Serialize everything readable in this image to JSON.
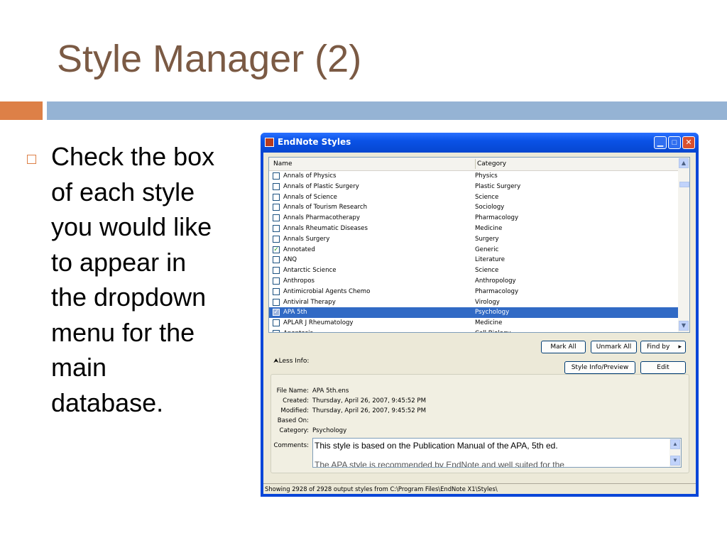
{
  "slide": {
    "title": "Style Manager (2)",
    "bullet": "Check the box of each style you would like to appear in the dropdown menu for the main database.",
    "colors": {
      "title": "#7b5a44",
      "accent_orange": "#dd8047",
      "accent_blue": "#95b3d4"
    }
  },
  "window": {
    "title": "EndNote Styles",
    "controls": {
      "minimize": "minimize-icon",
      "maximize": "maximize-icon",
      "close": "close-icon"
    },
    "list": {
      "columns": {
        "name": "Name",
        "category": "Category"
      },
      "rows": [
        {
          "name": "Annals of Physics",
          "category": "Physics",
          "checked": false,
          "selected": false
        },
        {
          "name": "Annals of Plastic Surgery",
          "category": "Plastic Surgery",
          "checked": false,
          "selected": false
        },
        {
          "name": "Annals of Science",
          "category": "Science",
          "checked": false,
          "selected": false
        },
        {
          "name": "Annals of Tourism Research",
          "category": "Sociology",
          "checked": false,
          "selected": false
        },
        {
          "name": "Annals Pharmacotherapy",
          "category": "Pharmacology",
          "checked": false,
          "selected": false
        },
        {
          "name": "Annals Rheumatic Diseases",
          "category": "Medicine",
          "checked": false,
          "selected": false
        },
        {
          "name": "Annals Surgery",
          "category": "Surgery",
          "checked": false,
          "selected": false
        },
        {
          "name": "Annotated",
          "category": "Generic",
          "checked": true,
          "selected": false
        },
        {
          "name": "ANQ",
          "category": "Literature",
          "checked": false,
          "selected": false
        },
        {
          "name": "Antarctic Science",
          "category": "Science",
          "checked": false,
          "selected": false
        },
        {
          "name": "Anthropos",
          "category": "Anthropology",
          "checked": false,
          "selected": false
        },
        {
          "name": "Antimicrobial Agents Chemo",
          "category": "Pharmacology",
          "checked": false,
          "selected": false
        },
        {
          "name": "Antiviral Therapy",
          "category": "Virology",
          "checked": false,
          "selected": false
        },
        {
          "name": "APA 5th",
          "category": "Psychology",
          "checked": true,
          "selected": true
        },
        {
          "name": "APLAR J Rheumatology",
          "category": "Medicine",
          "checked": false,
          "selected": false
        },
        {
          "name": "Apoptosis",
          "category": "Cell Biology",
          "checked": false,
          "selected": false
        }
      ]
    },
    "buttons": {
      "mark_all": "Mark All",
      "unmark_all": "Unmark All",
      "find_by": "Find by",
      "style_info": "Style Info/Preview",
      "edit": "Edit"
    },
    "less_info": "Less Info:",
    "info": {
      "file_name_label": "File Name:",
      "file_name": "APA 5th.ens",
      "created_label": "Created:",
      "created": "Thursday, April 26, 2007, 9:45:52 PM",
      "modified_label": "Modified:",
      "modified": "Thursday, April 26, 2007, 9:45:52 PM",
      "based_on_label": "Based On:",
      "based_on": "",
      "category_label": "Category:",
      "category": "Psychology",
      "comments_label": "Comments:",
      "comments": "This style is based on the Publication Manual of the APA, 5th ed.",
      "comments_line2": "The APA style is recommended by EndNote and well suited for the"
    },
    "status": "Showing 2928 of 2928 output styles from C:\\Program Files\\EndNote X1\\Styles\\"
  }
}
